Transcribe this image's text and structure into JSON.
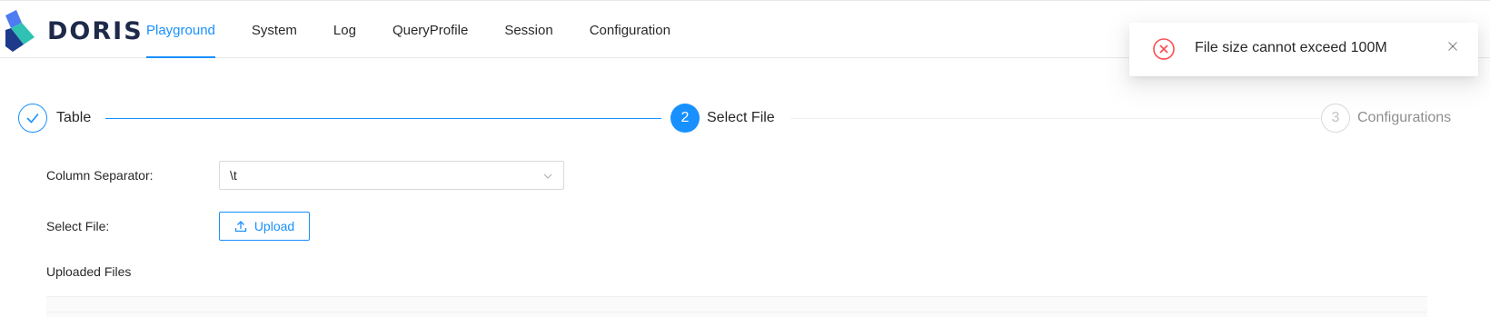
{
  "brand": {
    "name": "DORIS"
  },
  "nav": {
    "items": [
      {
        "label": "Playground",
        "active": true
      },
      {
        "label": "System",
        "active": false
      },
      {
        "label": "Log",
        "active": false
      },
      {
        "label": "QueryProfile",
        "active": false
      },
      {
        "label": "Session",
        "active": false
      },
      {
        "label": "Configuration",
        "active": false
      }
    ]
  },
  "steps": [
    {
      "number": "1",
      "title": "Table",
      "status": "finished"
    },
    {
      "number": "2",
      "title": "Select File",
      "status": "process"
    },
    {
      "number": "3",
      "title": "Configurations",
      "status": "wait"
    }
  ],
  "form": {
    "column_separator": {
      "label": "Column Separator",
      "value": "\\t"
    },
    "select_file": {
      "label": "Select File",
      "button_label": "Upload"
    },
    "uploaded_files_title": "Uploaded Files"
  },
  "notification": {
    "type": "error",
    "message": "File size cannot exceed 100M",
    "icon": "close-circle-icon"
  },
  "colors": {
    "primary": "#1890ff",
    "error": "#ff4d4f",
    "text": "rgba(0,0,0,0.85)",
    "disabled": "rgba(0,0,0,0.25)",
    "border": "#d9d9d9"
  },
  "icons": {
    "logo": "doris-logo-icon",
    "check": "check-icon",
    "dropdown": "chevron-down-icon",
    "upload": "upload-icon",
    "close": "close-icon"
  }
}
